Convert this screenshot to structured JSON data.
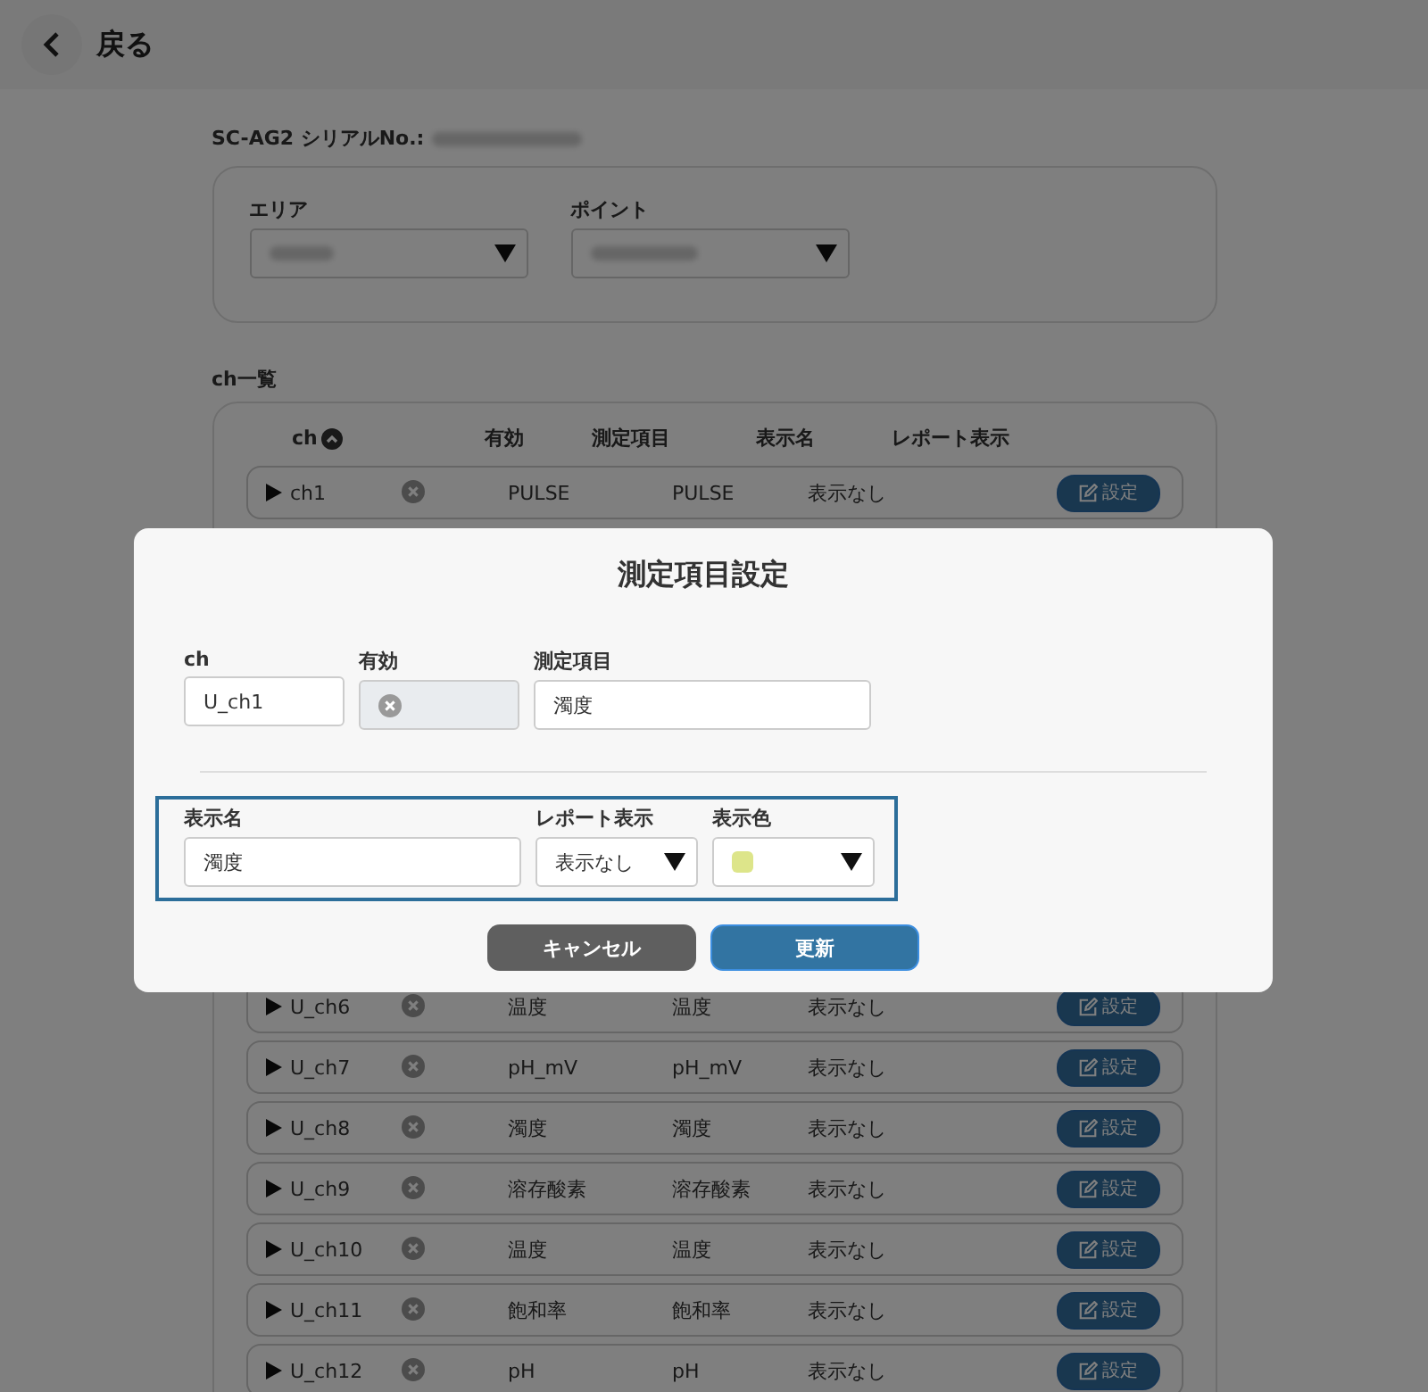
{
  "header": {
    "back_label": "戻る"
  },
  "device": {
    "serial_label": "SC-AG2 シリアルNo.:",
    "area_label": "エリア",
    "point_label": "ポイント"
  },
  "channel_list": {
    "title": "ch一覧",
    "columns": [
      "ch",
      "有効",
      "測定項目",
      "表示名",
      "レポート表示"
    ],
    "sort_ascending": true,
    "rows": [
      {
        "ch": "ch1",
        "enabled": false,
        "measure": "PULSE",
        "display": "PULSE",
        "report": "表示なし",
        "button": "設定"
      },
      {
        "ch": "U_ch6",
        "enabled": false,
        "measure": "温度",
        "display": "温度",
        "report": "表示なし",
        "button": "設定"
      },
      {
        "ch": "U_ch7",
        "enabled": false,
        "measure": "pH_mV",
        "display": "pH_mV",
        "report": "表示なし",
        "button": "設定"
      },
      {
        "ch": "U_ch8",
        "enabled": false,
        "measure": "濁度",
        "display": "濁度",
        "report": "表示なし",
        "button": "設定"
      },
      {
        "ch": "U_ch9",
        "enabled": false,
        "measure": "溶存酸素",
        "display": "溶存酸素",
        "report": "表示なし",
        "button": "設定"
      },
      {
        "ch": "U_ch10",
        "enabled": false,
        "measure": "温度",
        "display": "温度",
        "report": "表示なし",
        "button": "設定"
      },
      {
        "ch": "U_ch11",
        "enabled": false,
        "measure": "飽和率",
        "display": "飽和率",
        "report": "表示なし",
        "button": "設定"
      },
      {
        "ch": "U_ch12",
        "enabled": false,
        "measure": "pH",
        "display": "pH",
        "report": "表示なし",
        "button": "設定"
      }
    ]
  },
  "dialog": {
    "title": "測定項目設定",
    "ch_label": "ch",
    "ch_value": "U_ch1",
    "enabled_label": "有効",
    "enabled": false,
    "measure_label": "測定項目",
    "measure_value": "濁度",
    "display_label": "表示名",
    "display_value": "濁度",
    "report_label": "レポート表示",
    "report_value": "表示なし",
    "color_label": "表示色",
    "color": "#dde58a",
    "cancel_label": "キャンセル",
    "update_label": "更新"
  }
}
